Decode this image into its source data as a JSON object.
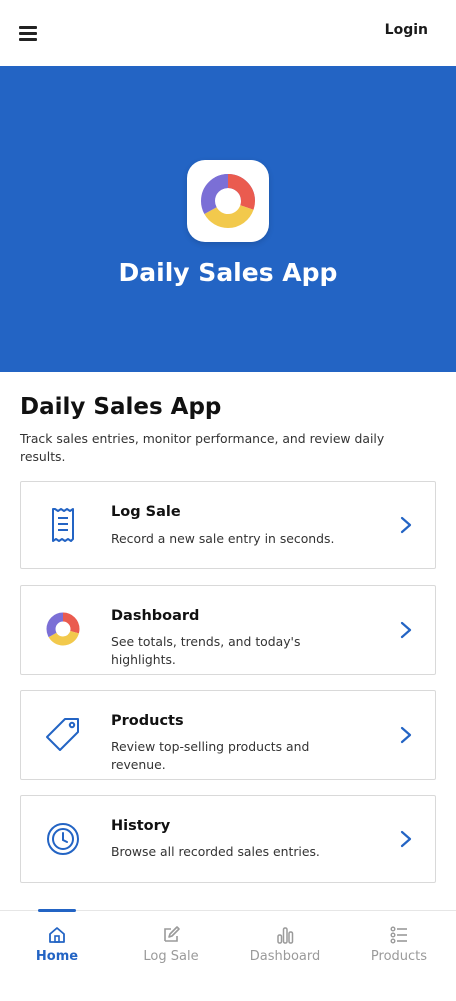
{
  "header": {
    "menu_icon": "hamburger-menu-icon",
    "login_label": "Login"
  },
  "hero": {
    "logo_icon": "donut-chart-icon",
    "title": "Daily Sales App"
  },
  "main": {
    "title": "Daily Sales App",
    "subtitle": "Track sales entries, monitor performance, and review daily results.",
    "cards": [
      {
        "icon": "receipt-icon",
        "title": "Log Sale",
        "description": "Record a new sale entry in seconds."
      },
      {
        "icon": "donut-chart-icon",
        "title": "Dashboard",
        "description": "See totals, trends, and today's highlights."
      },
      {
        "icon": "tag-icon",
        "title": "Products",
        "description": "Review top-selling products and revenue."
      },
      {
        "icon": "clock-icon",
        "title": "History",
        "description": "Browse all recorded sales entries."
      }
    ]
  },
  "bottom_nav": {
    "items": [
      {
        "icon": "home-icon",
        "label": "Home",
        "active": true
      },
      {
        "icon": "edit-icon",
        "label": "Log Sale",
        "active": false
      },
      {
        "icon": "bar-chart-icon",
        "label": "Dashboard",
        "active": false
      },
      {
        "icon": "list-icon",
        "label": "Products",
        "active": false
      }
    ]
  },
  "colors": {
    "primary": "#2364c4",
    "donut_purple": "#7b6fd6",
    "donut_red": "#ea5b4f",
    "donut_yellow": "#f2c94c",
    "inactive": "#9a9a9a"
  }
}
